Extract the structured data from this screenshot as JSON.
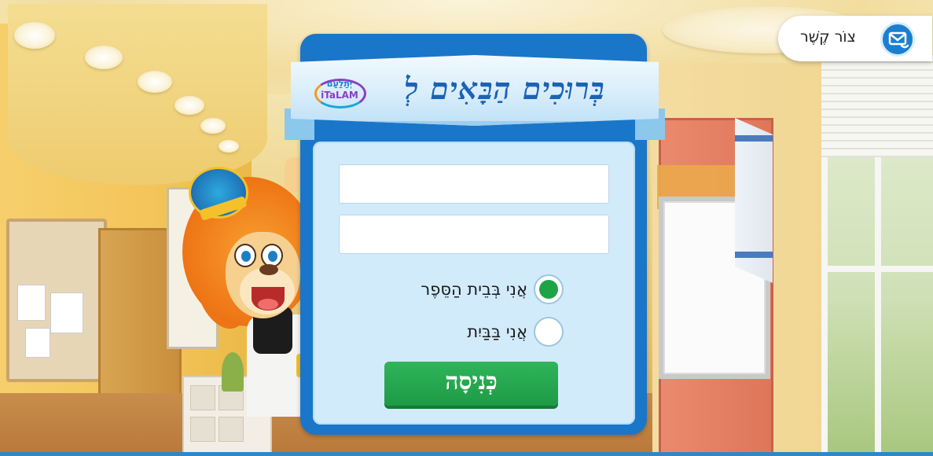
{
  "header": {
    "welcome_text": "בְּרוּכִים הַבָּאִים לְ",
    "logo_text_hebrew": "יְתַלַעַם",
    "logo_text_latin": "iTaLAM"
  },
  "contact": {
    "label": "צוֹר קֶשֶׁר",
    "icon": "envelope-phone-icon"
  },
  "login": {
    "username_value": "",
    "password_value": "",
    "options": [
      {
        "label": "אֲנִי בְּבֵית הַסֵּפֶר",
        "selected": true
      },
      {
        "label": "אֲנִי בַּבַּיִת",
        "selected": false
      }
    ],
    "enter_label": "כְּנִיסָה"
  },
  "colors": {
    "panel_blue": "#1a76c8",
    "inner_light_blue": "#d2ebfb",
    "button_green": "#1fa347",
    "radio_selected": "#1fa347"
  }
}
